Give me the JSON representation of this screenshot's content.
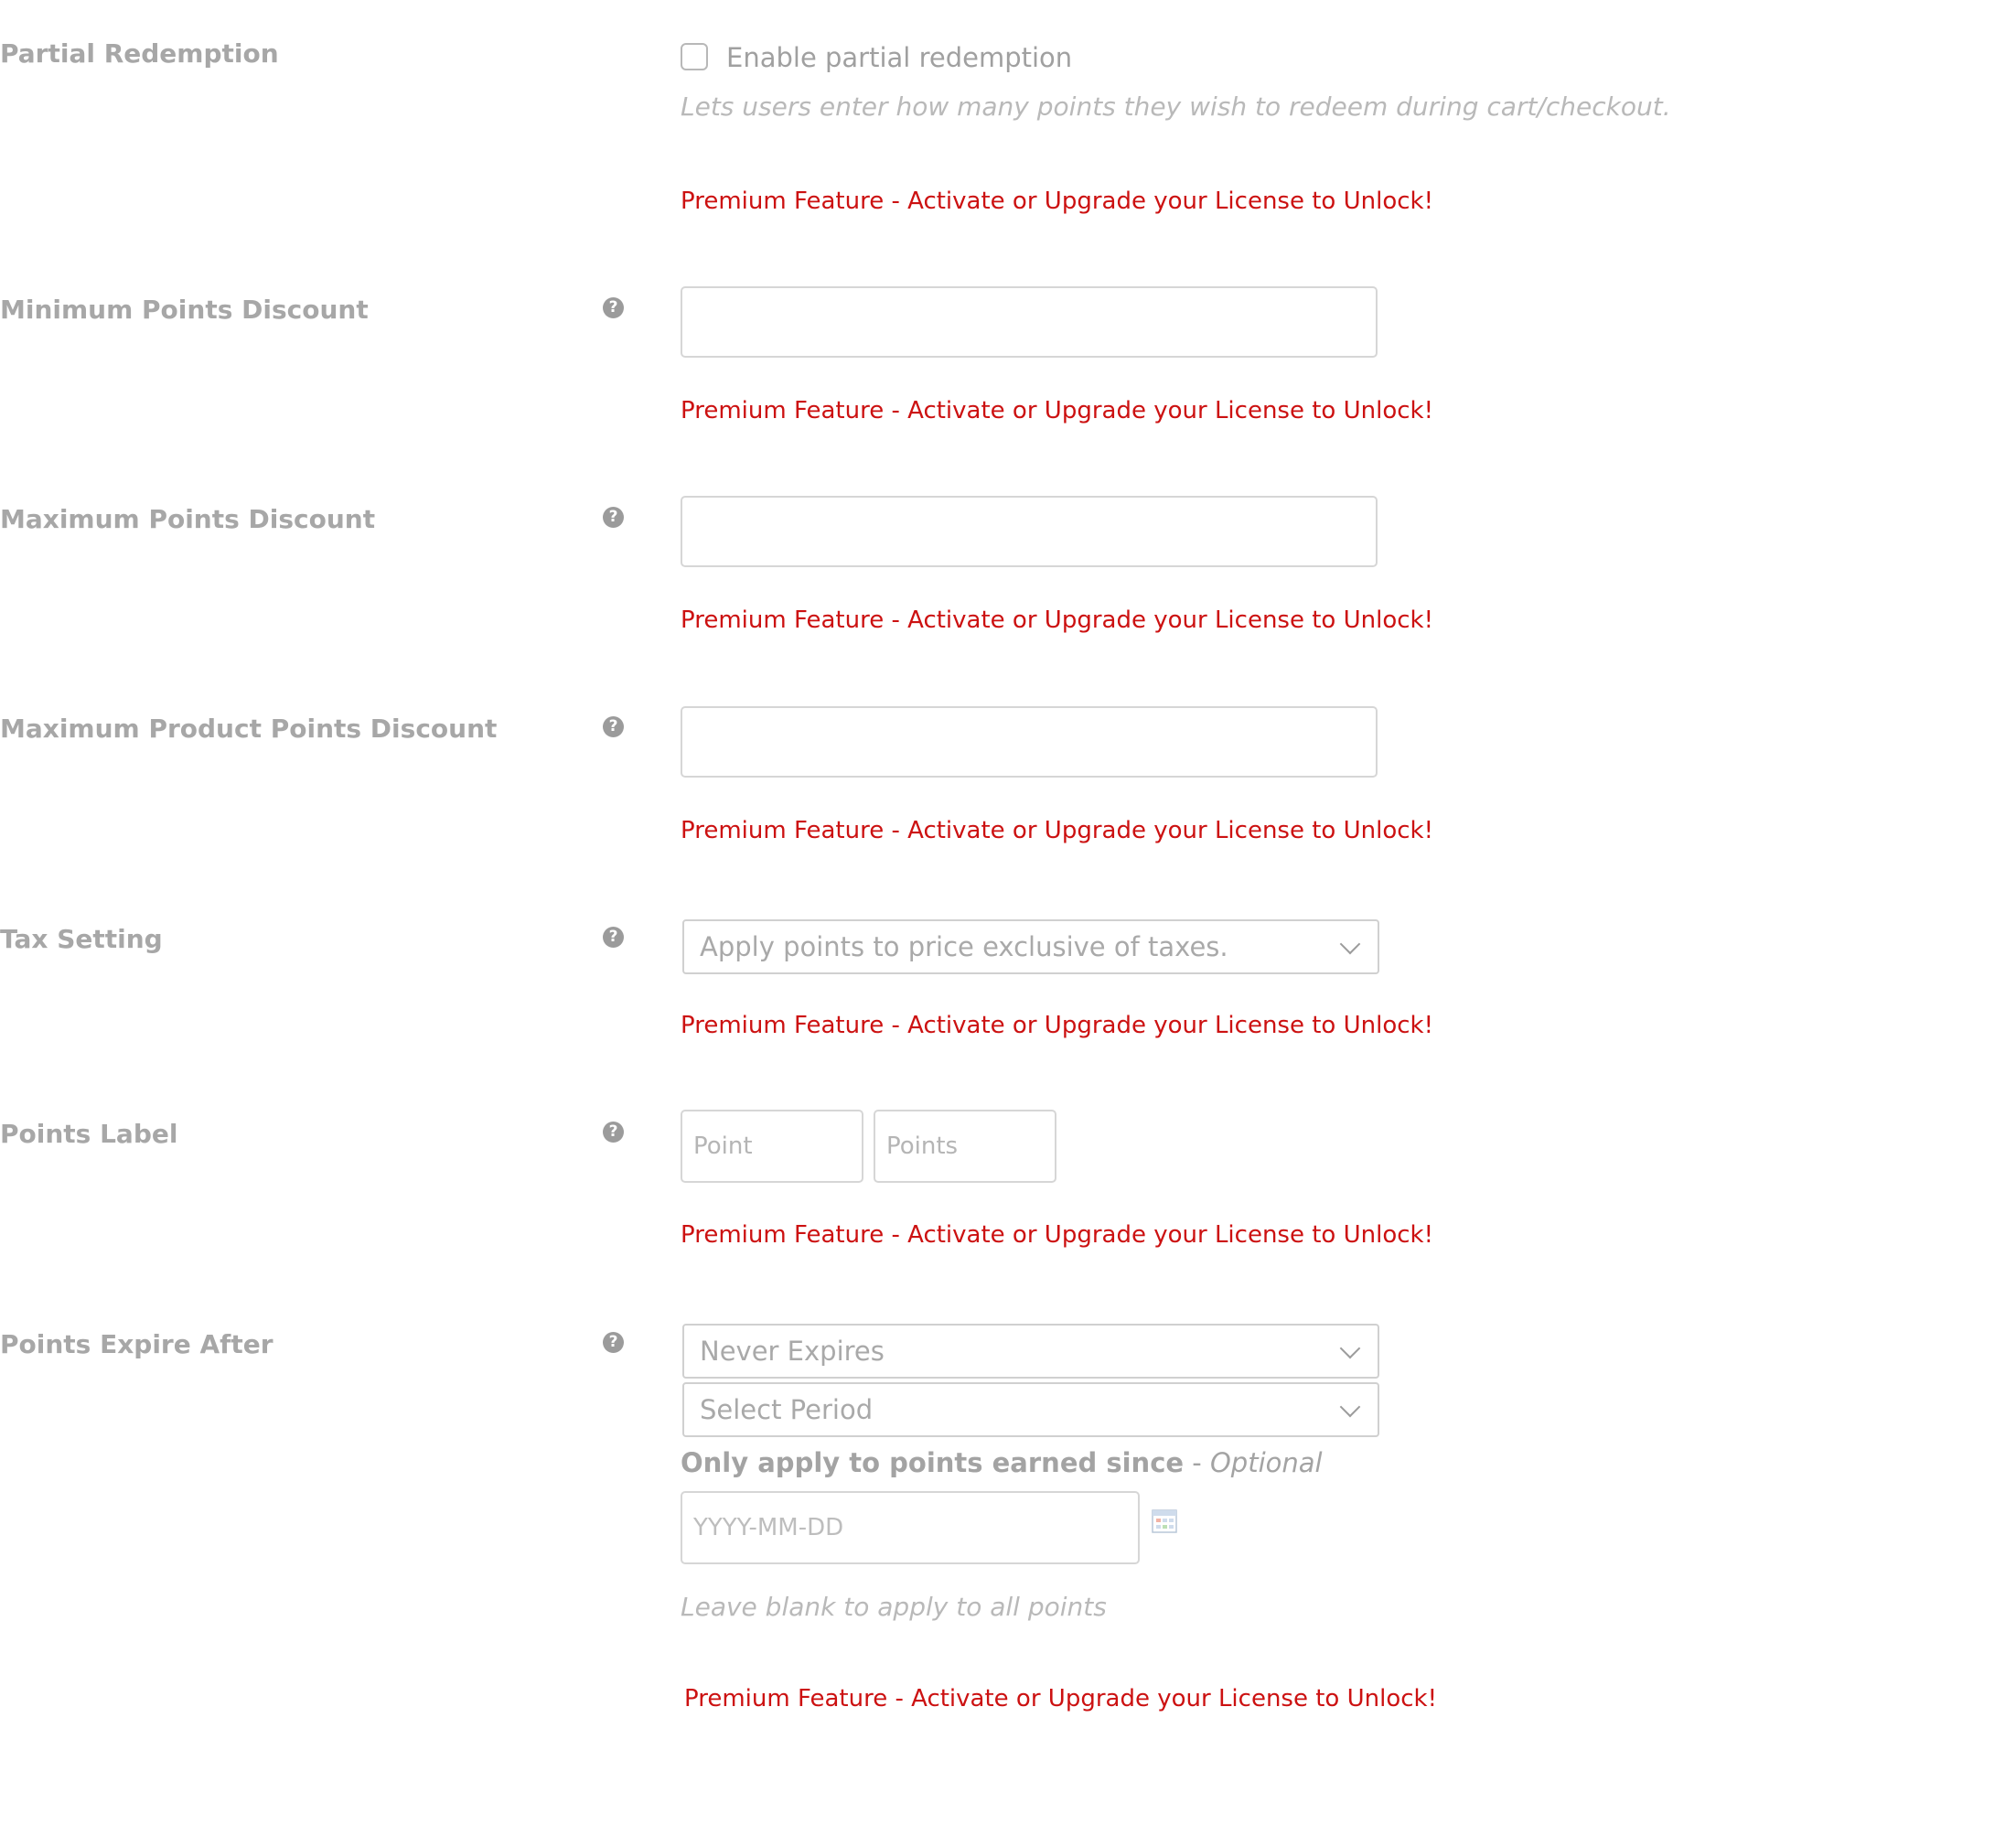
{
  "rows": {
    "partial_redemption": {
      "label": "Partial Redemption",
      "checkbox_label": "Enable partial redemption",
      "checked": false,
      "description": "Lets users enter how many points they wish to redeem during cart/checkout.",
      "premium": "Premium Feature - Activate or Upgrade your License to Unlock!"
    },
    "min_points_discount": {
      "label": "Minimum Points Discount",
      "help": "?",
      "value": "",
      "premium": "Premium Feature - Activate or Upgrade your License to Unlock!"
    },
    "max_points_discount": {
      "label": "Maximum Points Discount",
      "help": "?",
      "value": "",
      "premium": "Premium Feature - Activate or Upgrade your License to Unlock!"
    },
    "max_product_points_discount": {
      "label": "Maximum Product Points Discount",
      "help": "?",
      "value": "",
      "premium": "Premium Feature - Activate or Upgrade your License to Unlock!"
    },
    "tax_setting": {
      "label": "Tax Setting",
      "help": "?",
      "selected": "Apply points to price exclusive of taxes.",
      "premium": "Premium Feature - Activate or Upgrade your License to Unlock!"
    },
    "points_label": {
      "label": "Points Label",
      "help": "?",
      "singular_placeholder": "Point",
      "plural_placeholder": "Points",
      "premium": "Premium Feature - Activate or Upgrade your License to Unlock!"
    },
    "points_expire": {
      "label": "Points Expire After",
      "help": "?",
      "expiry_selected": "Never Expires",
      "period_selected": "Select Period",
      "since_label": "Only apply to points earned since",
      "since_separator": " - ",
      "since_optional": "Optional",
      "date_placeholder": "YYYY-MM-DD",
      "date_hint": "Leave blank to apply to all points",
      "premium": "Premium Feature - Activate or Upgrade your License to Unlock!"
    }
  },
  "colors": {
    "label": "#a7a7a7",
    "premium": "#cc1111",
    "border": "#d6d6d6"
  },
  "icons": {
    "help": "question-circle-icon",
    "select": "chevron-down-icon",
    "calendar": "calendar-icon"
  }
}
